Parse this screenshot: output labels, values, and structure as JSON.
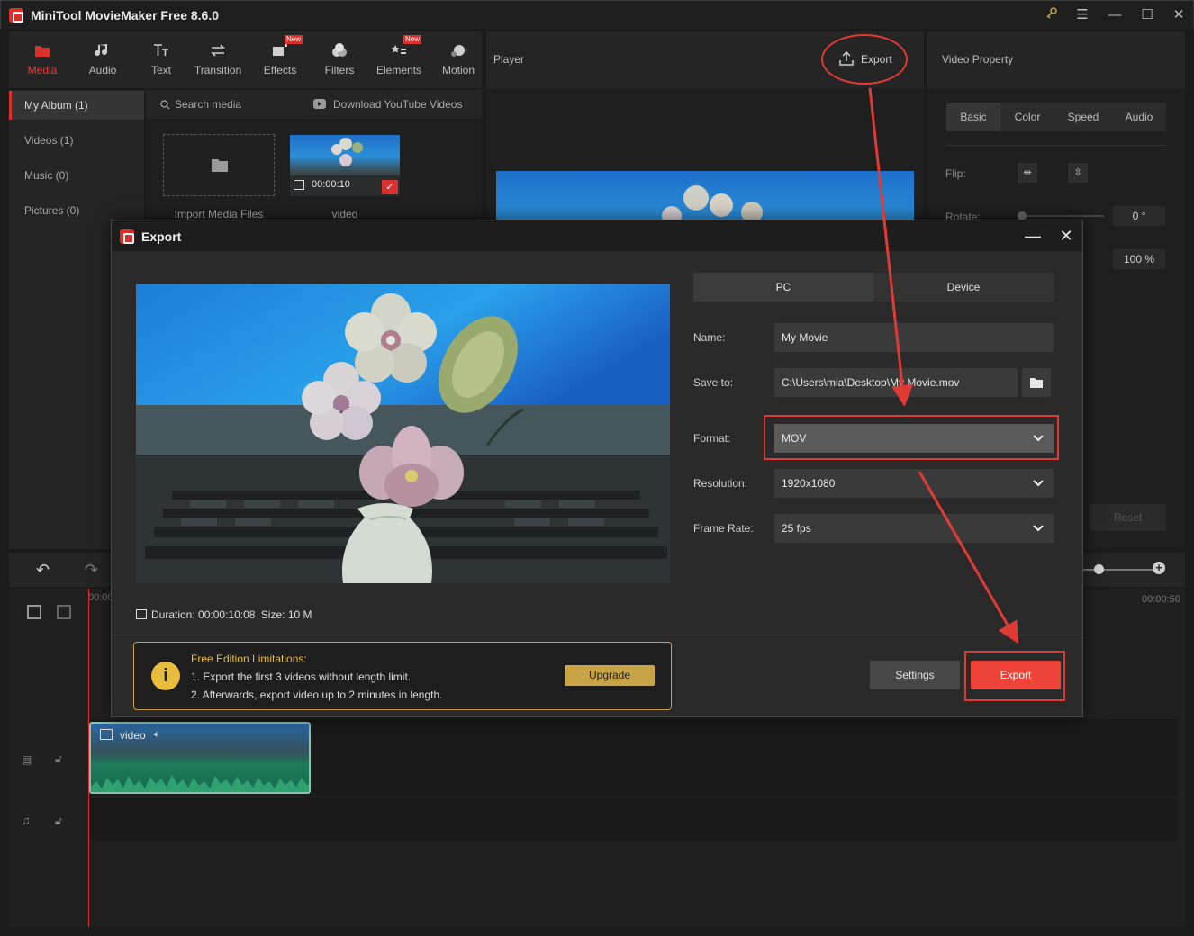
{
  "app": {
    "title": "MiniTool MovieMaker Free 8.6.0"
  },
  "toolbar": {
    "items": [
      {
        "label": "Media",
        "icon": "media-folder-icon",
        "active": true,
        "new": false
      },
      {
        "label": "Audio",
        "icon": "music-note-icon",
        "active": false,
        "new": false
      },
      {
        "label": "Text",
        "icon": "text-icon",
        "active": false,
        "new": false
      },
      {
        "label": "Transition",
        "icon": "transition-icon",
        "active": false,
        "new": false
      },
      {
        "label": "Effects",
        "icon": "effects-icon",
        "active": false,
        "new": true
      },
      {
        "label": "Filters",
        "icon": "filters-icon",
        "active": false,
        "new": false
      },
      {
        "label": "Elements",
        "icon": "elements-icon",
        "active": false,
        "new": true
      },
      {
        "label": "Motion",
        "icon": "motion-icon",
        "active": false,
        "new": false
      }
    ],
    "new_badge": "New"
  },
  "left_nav": {
    "items": [
      "My Album (1)",
      "Videos (1)",
      "Music (0)",
      "Pictures (0)"
    ]
  },
  "media": {
    "search_placeholder": "Search media",
    "download_label": "Download YouTube Videos",
    "import_label": "Import Media Files",
    "clip_label": "video",
    "clip_duration": "00:00:10"
  },
  "player": {
    "title": "Player",
    "export_label": "Export"
  },
  "property": {
    "title": "Video Property",
    "tabs": [
      "Basic",
      "Color",
      "Speed",
      "Audio"
    ],
    "flip_label": "Flip:",
    "rotate_label": "Rotate:",
    "rotate_value": "0 °",
    "scale_value": "100 %",
    "reset_label": "Reset"
  },
  "timeline": {
    "start_time": "00:00",
    "end_time": "00:00:50",
    "clip_label": "video"
  },
  "export_dialog": {
    "title": "Export",
    "tabs": [
      "PC",
      "Device"
    ],
    "name_label": "Name:",
    "name_value": "My Movie",
    "save_label": "Save to:",
    "save_value": "C:\\Users\\mia\\Desktop\\My Movie.mov",
    "format_label": "Format:",
    "format_value": "MOV",
    "resolution_label": "Resolution:",
    "resolution_value": "1920x1080",
    "framerate_label": "Frame Rate:",
    "framerate_value": "25 fps",
    "duration_label": "Duration:",
    "duration_value": "00:00:10:08",
    "size_label": "Size:",
    "size_value": "10 M",
    "limit_title": "Free Edition Limitations:",
    "limit_line1": "1. Export the first 3 videos without length limit.",
    "limit_line2": "2. Afterwards, export video up to 2 minutes in length.",
    "upgrade_label": "Upgrade",
    "settings_label": "Settings",
    "export_label": "Export"
  },
  "colors": {
    "accent": "#d8312e",
    "export_button": "#ee4339",
    "upgrade_button": "#c9a447",
    "annotation": "#e03a35"
  }
}
